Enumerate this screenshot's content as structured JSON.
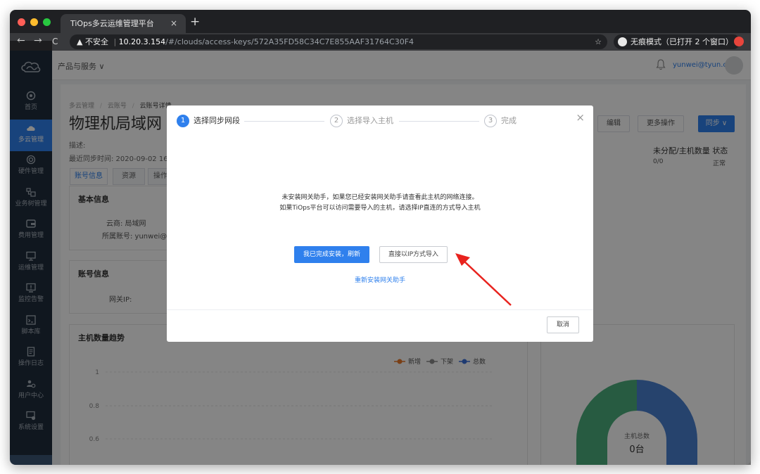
{
  "browser": {
    "tab_title": "TiOps多云运维管理平台",
    "tab_close": "×",
    "new_tab": "+",
    "back": "←",
    "forward": "→",
    "reload": "C",
    "warning": "▲ 不安全",
    "url_host": "10.20.3.154",
    "url_path": "/#/clouds/access-keys/572A35FD58C34C7E855AAF31764C30F4",
    "star": "☆",
    "incognito": "无痕模式（已打开 2 个窗口）"
  },
  "sidebar": {
    "items": [
      {
        "label": "首页",
        "icon": "home-icon"
      },
      {
        "label": "多云管理",
        "icon": "cloud-icon"
      },
      {
        "label": "硬件管理",
        "icon": "hardware-icon"
      },
      {
        "label": "业务树管理",
        "icon": "tree-icon"
      },
      {
        "label": "费用管理",
        "icon": "wallet-icon"
      },
      {
        "label": "运维管理",
        "icon": "monitor-icon"
      },
      {
        "label": "监控告警",
        "icon": "alert-icon"
      },
      {
        "label": "脚本库",
        "icon": "script-icon"
      },
      {
        "label": "操作日志",
        "icon": "log-icon"
      },
      {
        "label": "用户中心",
        "icon": "users-icon"
      },
      {
        "label": "系统设置",
        "icon": "settings-icon"
      }
    ],
    "active_index": 1
  },
  "header": {
    "products": "产品与服务 ∨",
    "user": "yunwei@tyun.cn"
  },
  "page": {
    "crumb1": "多云管理",
    "crumb2": "云账号",
    "crumb3": "云账号详情",
    "sep": "/",
    "title": "物理机局域网",
    "desc": "描述:",
    "sync_time": "最近同步时间: 2020-09-02 16:4",
    "tabs": [
      "账号信息",
      "资源",
      "操作"
    ],
    "basic_title": "基本信息",
    "cloud_vendor": "云商:  局域网",
    "account": "所属账号:  yunwei@",
    "account_title": "账号信息",
    "gateway_ip": "网关IP:",
    "trend_title": "主机数量趋势",
    "btn_edit": "编辑",
    "btn_more": "更多操作",
    "btn_sync": "同步 ∨",
    "stat_head": "未分配/主机数量  状态",
    "stat_value": "0/0",
    "stat_status": "正常",
    "donut_label": "主机总数",
    "donut_value": "0台"
  },
  "chart_data": {
    "type": "line",
    "title": "主机数量趋势",
    "series": [
      {
        "name": "新增",
        "color": "#e8792b",
        "values": []
      },
      {
        "name": "下架",
        "color": "#8c8c8c",
        "values": []
      },
      {
        "name": "总数",
        "color": "#3a6fd8",
        "values": []
      }
    ],
    "y_ticks": [
      "1",
      "0.8",
      "0.6"
    ],
    "xlabel": "",
    "ylabel": ""
  },
  "modal": {
    "steps": [
      {
        "num": "1",
        "label": "选择同步网段"
      },
      {
        "num": "2",
        "label": "选择导入主机"
      },
      {
        "num": "3",
        "label": "完成"
      }
    ],
    "close": "×",
    "msg_line1": "未安装网关助手，如果您已经安装网关助手请查看此主机的网络连接。",
    "msg_line2": "如果TiOps平台可以访问需要导入的主机，请选择IP直连的方式导入主机",
    "btn_refresh": "我已完成安装，刷新",
    "btn_ip": "直接以IP方式导入",
    "link_reinstall": "重新安装网关助手",
    "btn_cancel": "取消"
  },
  "colors": {
    "accent": "#2f80ed",
    "sidebar_bg": "#1f2d3d",
    "arrow": "#e8231e",
    "donut_green": "#4cae7e",
    "donut_blue": "#4a80d1"
  }
}
